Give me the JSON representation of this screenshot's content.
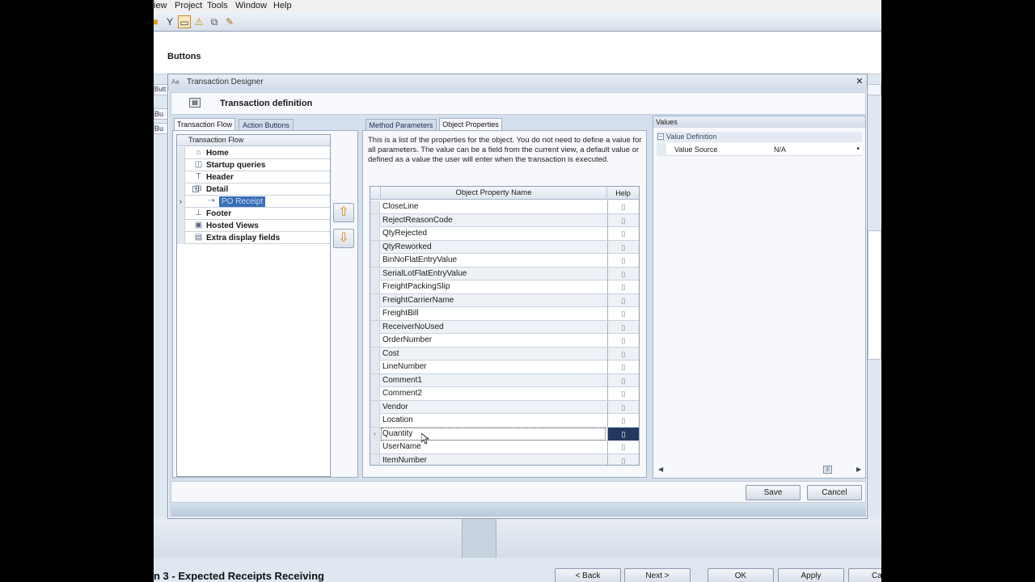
{
  "menubar": {
    "items": [
      "iew",
      "Project",
      "Tools",
      "Window",
      "Help"
    ]
  },
  "toolbar": {
    "icons": [
      "folder-icon",
      "filter-icon",
      "screen-icon",
      "warning-icon",
      "window-icon",
      "pencil-icon"
    ]
  },
  "background": {
    "panel_title": "Buttons",
    "wizard_title": "n 3 - Expected Receipts Receiving",
    "buttons": {
      "back": "< Back",
      "next": "Next >",
      "ok": "OK",
      "apply": "Apply",
      "cancel": "Ca"
    },
    "side_fragments": {
      "a": "Butt",
      "b": "Bu",
      "c": "Bu"
    }
  },
  "dialog": {
    "title": "Transaction Designer",
    "header_title": "Transaction definition",
    "left_tabs": [
      "Transaction Flow",
      "Action Buttons"
    ],
    "middle_tabs": [
      "Method Parameters",
      "Object Properties"
    ],
    "tree": {
      "header": "Transaction Flow",
      "items": [
        {
          "label": "Home",
          "icon": "home-icon"
        },
        {
          "label": "Startup queries",
          "icon": "query-icon"
        },
        {
          "label": "Header",
          "icon": "header-icon"
        },
        {
          "label": "Detail",
          "icon": "detail-icon"
        },
        {
          "label": "PO Receipt",
          "icon": "receipt-icon"
        },
        {
          "label": "Footer",
          "icon": "footer-icon"
        },
        {
          "label": "Hosted Views",
          "icon": "views-icon"
        },
        {
          "label": "Extra display fields",
          "icon": "fields-icon"
        }
      ]
    },
    "description": "This is a list of the properties for the object.  You do not need to define a value for all parameters.  The value can be a field from the current view, a default value or defined as a value the user will enter when the transaction is executed.",
    "grid": {
      "col_name": "Object Property Name",
      "col_help": "Help",
      "rows": [
        "CloseLine",
        "RejectReasonCode",
        "QtyRejected",
        "QtyReworked",
        "BinNoFlatEntryValue",
        "SerialLotFlatEntryValue",
        "FreightPackingSlip",
        "FreightCarrierName",
        "FreightBill",
        "ReceiverNoUsed",
        "OrderNumber",
        "Cost",
        "LineNumber",
        "Comment1",
        "Comment2",
        "Vendor",
        "Location",
        "Quantity",
        "UserName",
        "ItemNumber"
      ],
      "current_row": "Quantity"
    },
    "values_panel": {
      "title": "Values",
      "section": "Value Definition",
      "row_label": "Value Source",
      "row_value": "N/A"
    },
    "buttons": {
      "save": "Save",
      "cancel": "Cancel"
    }
  }
}
